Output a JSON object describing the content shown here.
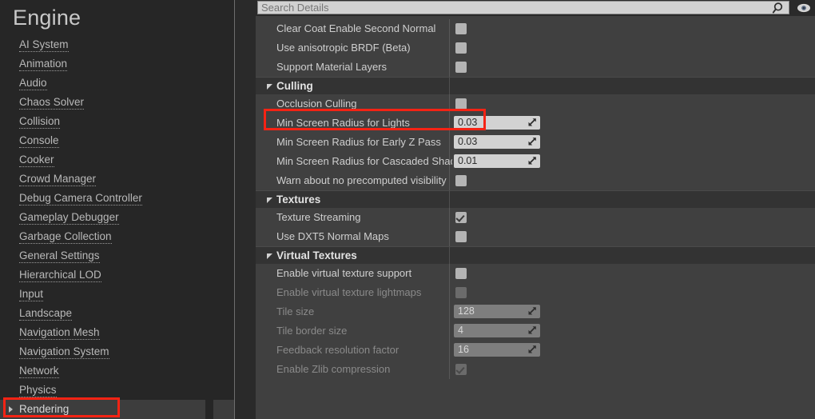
{
  "sidebar": {
    "title": "Engine",
    "items": [
      {
        "label": "AI System",
        "selected": false,
        "expandable": false
      },
      {
        "label": "Animation",
        "selected": false,
        "expandable": false
      },
      {
        "label": "Audio",
        "selected": false,
        "expandable": false
      },
      {
        "label": "Chaos Solver",
        "selected": false,
        "expandable": false
      },
      {
        "label": "Collision",
        "selected": false,
        "expandable": false
      },
      {
        "label": "Console",
        "selected": false,
        "expandable": false
      },
      {
        "label": "Cooker",
        "selected": false,
        "expandable": false
      },
      {
        "label": "Crowd Manager",
        "selected": false,
        "expandable": false
      },
      {
        "label": "Debug Camera Controller",
        "selected": false,
        "expandable": false
      },
      {
        "label": "Gameplay Debugger",
        "selected": false,
        "expandable": false
      },
      {
        "label": "Garbage Collection",
        "selected": false,
        "expandable": false
      },
      {
        "label": "General Settings",
        "selected": false,
        "expandable": false
      },
      {
        "label": "Hierarchical LOD",
        "selected": false,
        "expandable": false
      },
      {
        "label": "Input",
        "selected": false,
        "expandable": false
      },
      {
        "label": "Landscape",
        "selected": false,
        "expandable": false
      },
      {
        "label": "Navigation Mesh",
        "selected": false,
        "expandable": false
      },
      {
        "label": "Navigation System",
        "selected": false,
        "expandable": false
      },
      {
        "label": "Network",
        "selected": false,
        "expandable": false
      },
      {
        "label": "Physics",
        "selected": false,
        "expandable": false
      },
      {
        "label": "Rendering",
        "selected": true,
        "expandable": true
      }
    ]
  },
  "search": {
    "placeholder": "Search Details",
    "value": "",
    "search_icon": "magnifier-icon",
    "eye_icon": "eye-icon"
  },
  "details": {
    "groups": [
      {
        "header": null,
        "rows": [
          {
            "label": "Clear Coat Enable Second Normal",
            "control": "checkbox",
            "checked": false,
            "disabled": false
          },
          {
            "label": "Use anisotropic BRDF (Beta)",
            "control": "checkbox",
            "checked": false,
            "disabled": false
          },
          {
            "label": "Support Material Layers",
            "control": "checkbox",
            "checked": false,
            "disabled": false
          }
        ]
      },
      {
        "header": "Culling",
        "rows": [
          {
            "label": "Occlusion Culling",
            "control": "checkbox",
            "checked": false,
            "disabled": false,
            "highlighted": true
          },
          {
            "label": "Min Screen Radius for Lights",
            "control": "number",
            "value": "0.03",
            "disabled": false
          },
          {
            "label": "Min Screen Radius for Early Z Pass",
            "control": "number",
            "value": "0.03",
            "disabled": false
          },
          {
            "label": "Min Screen Radius for Cascaded Shadow M",
            "control": "number",
            "value": "0.01",
            "disabled": false
          },
          {
            "label": "Warn about no precomputed visibility",
            "control": "checkbox",
            "checked": false,
            "disabled": false
          }
        ]
      },
      {
        "header": "Textures",
        "rows": [
          {
            "label": "Texture Streaming",
            "control": "checkbox",
            "checked": true,
            "disabled": false
          },
          {
            "label": "Use DXT5 Normal Maps",
            "control": "checkbox",
            "checked": false,
            "disabled": false
          }
        ]
      },
      {
        "header": "Virtual Textures",
        "rows": [
          {
            "label": "Enable virtual texture support",
            "control": "checkbox",
            "checked": false,
            "disabled": false
          },
          {
            "label": "Enable virtual texture lightmaps",
            "control": "checkbox",
            "checked": false,
            "disabled": true
          },
          {
            "label": "Tile size",
            "control": "number",
            "value": "128",
            "disabled": true
          },
          {
            "label": "Tile border size",
            "control": "number",
            "value": "4",
            "disabled": true
          },
          {
            "label": "Feedback resolution factor",
            "control": "number",
            "value": "16",
            "disabled": true
          },
          {
            "label": "Enable Zlib compression",
            "control": "checkbox",
            "checked": true,
            "disabled": true
          }
        ]
      }
    ]
  },
  "annotations": {
    "color": "#f42314",
    "boxes": [
      {
        "target": "Occlusion Culling"
      },
      {
        "target": "Rendering"
      }
    ]
  },
  "scrollbar": {
    "sidebar_thumb": "visible"
  }
}
